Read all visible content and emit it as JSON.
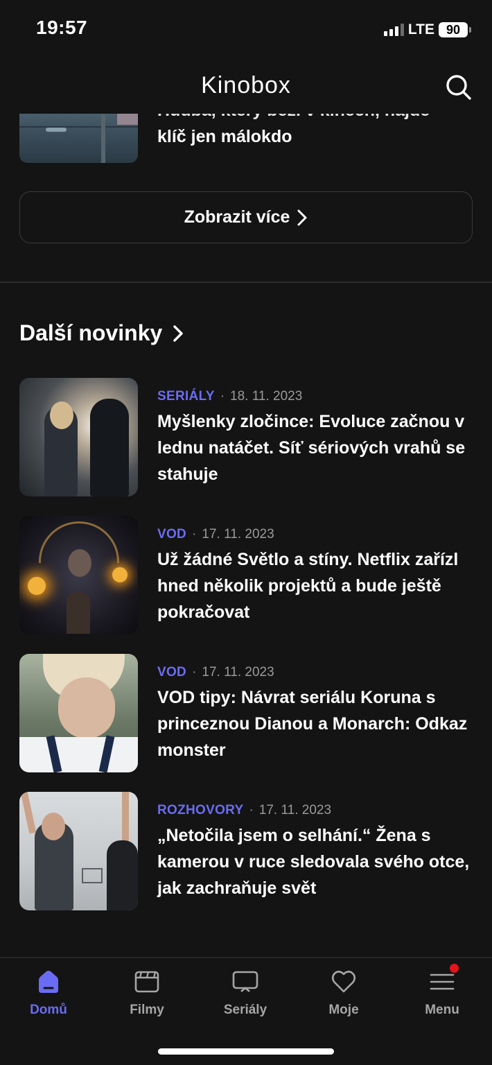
{
  "status_bar": {
    "time": "19:57",
    "network": "LTE",
    "battery": "90"
  },
  "header": {
    "brand": "Kinobox"
  },
  "previous_article": {
    "title_line1": "Hudba, který běží v kinech, najde",
    "title_line2": "klíč jen málokdo"
  },
  "more_button": {
    "label": "Zobrazit více"
  },
  "section": {
    "title": "Další novinky"
  },
  "news": [
    {
      "category": "SERIÁLY",
      "date": "18. 11. 2023",
      "title": "Myšlenky zločince: Evoluce začnou v lednu natáčet. Síť sériových vrahů se stahuje"
    },
    {
      "category": "VOD",
      "date": "17. 11. 2023",
      "title": "Už žádné Světlo a stíny. Netflix zařízl hned několik projektů a bude ještě pokračovat"
    },
    {
      "category": "VOD",
      "date": "17. 11. 2023",
      "title": "VOD tipy: Návrat seriálu Koruna s princeznou Dianou a Monarch: Odkaz monster"
    },
    {
      "category": "ROZHOVORY",
      "date": "17. 11. 2023",
      "title": "„Netočila jsem o selhání.“ Žena s kamerou v ruce sledovala svého otce, jak zachraňuje svět"
    }
  ],
  "tabs": [
    {
      "label": "Domů",
      "icon": "home-icon",
      "active": true
    },
    {
      "label": "Filmy",
      "icon": "film-icon"
    },
    {
      "label": "Seriály",
      "icon": "tv-icon"
    },
    {
      "label": "Moje",
      "icon": "heart-icon"
    },
    {
      "label": "Menu",
      "icon": "menu-icon",
      "notification": true
    }
  ],
  "colors": {
    "background": "#141414",
    "accent": "#6b6cf5",
    "notification": "#e5131c"
  }
}
